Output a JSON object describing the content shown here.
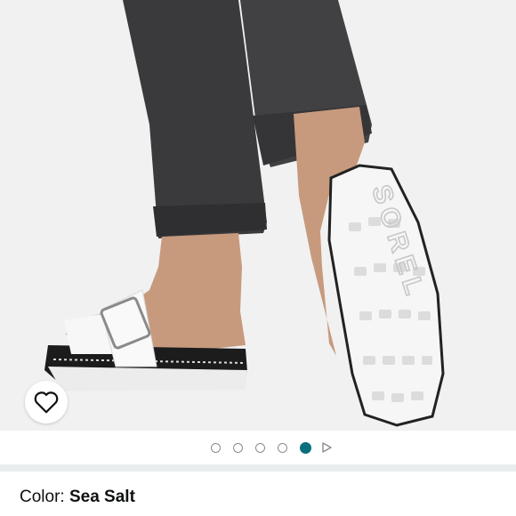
{
  "image": {
    "alt_icon": "product-photo",
    "sole_brand": "SOREL"
  },
  "wishlist": {
    "icon": "heart-outline-icon"
  },
  "carousel": {
    "dots": [
      {
        "active": false
      },
      {
        "active": false
      },
      {
        "active": false
      },
      {
        "active": false
      },
      {
        "active": true
      }
    ],
    "active_color": "#0b6e7e",
    "next_icon": "play-triangle-icon"
  },
  "color_selector": {
    "label": "Color:",
    "value": "Sea Salt"
  }
}
